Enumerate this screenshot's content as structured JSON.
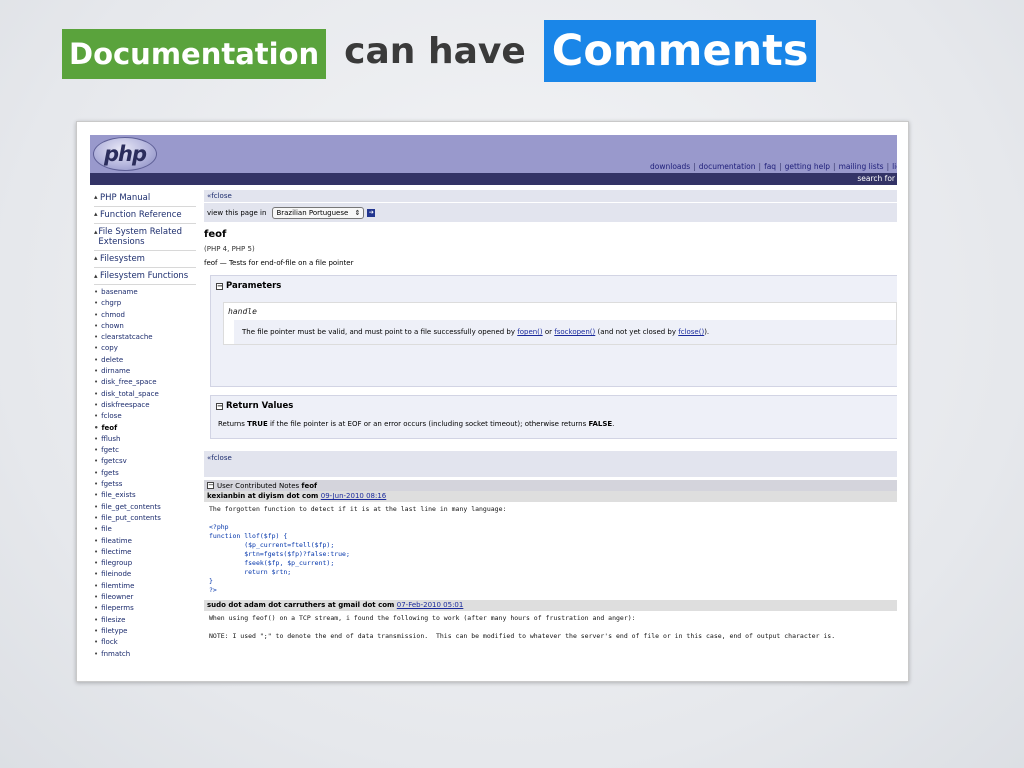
{
  "slide": {
    "word1": "Documentation",
    "word2": "can have",
    "word3": "Comments",
    "colors": {
      "green": "#5aa33c",
      "blue": "#1a86e8",
      "text": "#3a3a3a"
    }
  },
  "php": {
    "logo": "php",
    "top_links": [
      "downloads",
      "documentation",
      "faq",
      "getting help",
      "mailing lists",
      "lice"
    ],
    "search_label": "search for"
  },
  "sidebar": {
    "blocks": [
      "PHP Manual",
      "Function Reference",
      "File System Related Extensions",
      "Filesystem",
      "Filesystem Functions"
    ],
    "functions": [
      "basename",
      "chgrp",
      "chmod",
      "chown",
      "clearstatcache",
      "copy",
      "delete",
      "dirname",
      "disk_free_space",
      "disk_total_space",
      "diskfreespace",
      "fclose",
      "feof",
      "fflush",
      "fgetc",
      "fgetcsv",
      "fgets",
      "fgetss",
      "file_exists",
      "file_get_contents",
      "file_put_contents",
      "file",
      "fileatime",
      "filectime",
      "filegroup",
      "fileinode",
      "filemtime",
      "fileowner",
      "fileperms",
      "filesize",
      "filetype",
      "flock",
      "fnmatch"
    ],
    "current": "feof"
  },
  "content": {
    "nav_prev": "«fclose",
    "view_label": "view this page in",
    "language": "Brazilian Portuguese",
    "title": "feof",
    "version": "(PHP 4, PHP 5)",
    "description": "feof — Tests for end-of-file on a file pointer",
    "parameters": {
      "heading": "Parameters",
      "name": "handle",
      "desc_pre": "The file pointer must be valid, and must point to a file successfully opened by ",
      "link1": "fopen()",
      "desc_mid1": " or ",
      "link2": "fsockopen()",
      "desc_mid2": " (and not yet closed by ",
      "link3": "fclose()",
      "desc_post": ")."
    },
    "return_values": {
      "heading": "Return Values",
      "pre": "Returns ",
      "true": "TRUE",
      "mid": " if the file pointer is at EOF or an error occurs (including socket timeout); otherwise returns ",
      "false": "FALSE",
      "post": "."
    },
    "nav_prev_bottom": "«fclose",
    "ucn_label": "User Contributed Notes",
    "ucn_fn": "feof",
    "notes": [
      {
        "author": "kexianbin at diyism dot com",
        "date": "09-Jun-2010 08:16",
        "text": "The forgotten function to detect if it is at the last line in many language:",
        "code": "<?php\nfunction llof($fp) {\n         ($p_current=ftell($fp);\n         $rtn=fgets($fp)?false:true;\n         fseek($fp, $p_current);\n         return $rtn;\n}\n?>"
      },
      {
        "author": "sudo dot adam dot carruthers at gmail dot com",
        "date": "07-Feb-2010 05:01",
        "text": "When using feof() on a TCP stream, i found the following to work (after many hours of frustration and anger):\n\nNOTE: I used \";\" to denote the end of data transmission.  This can be modified to whatever the server's end of file or in this case, end of output character is."
      }
    ]
  }
}
